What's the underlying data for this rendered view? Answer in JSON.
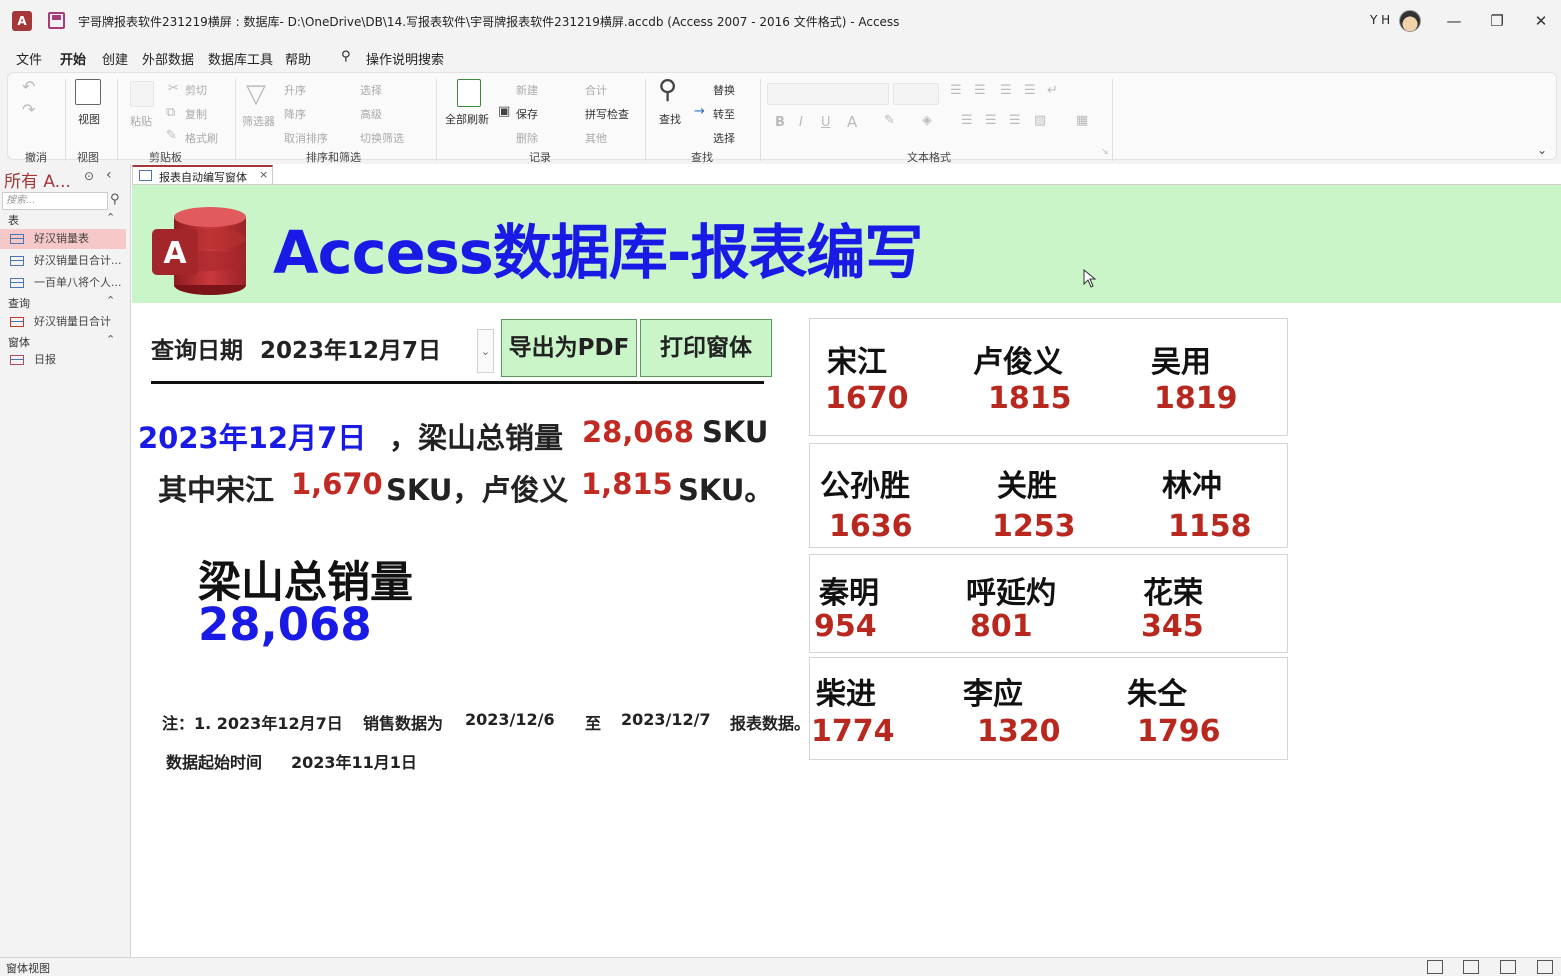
{
  "window": {
    "title": "宇哥牌报表软件231219横屏 : 数据库- D:\\OneDrive\\DB\\14.写报表软件\\宇哥牌报表软件231219横屏.accdb (Access 2007 - 2016 文件格式)  -  Access",
    "user": "Y H",
    "app_icon_letter": "A",
    "minimize": "—",
    "restore": "❐",
    "close": "✕"
  },
  "menu": {
    "items": [
      "文件",
      "开始",
      "创建",
      "外部数据",
      "数据库工具",
      "帮助"
    ],
    "active": "开始",
    "search": "操作说明搜索"
  },
  "ribbon": {
    "undo_group": "撤消",
    "view_group": "视图",
    "view_label": "视图",
    "clipboard_group": "剪贴板",
    "paste": "粘贴",
    "cut": "剪切",
    "copy": "复制",
    "format_painter": "格式刷",
    "sort_filter_group": "排序和筛选",
    "filter": "筛选器",
    "ascending": "升序",
    "descending": "降序",
    "remove_sort": "取消排序",
    "selection": "选择",
    "advanced": "高级",
    "toggle_filter": "切换筛选",
    "records_group": "记录",
    "refresh_all": "全部刷新",
    "new": "新建",
    "save": "保存",
    "delete": "删除",
    "totals": "合计",
    "spelling": "拼写检查",
    "more": "其他",
    "find_group": "查找",
    "find": "查找",
    "replace": "替换",
    "goto": "转至",
    "select": "选择",
    "text_format_group": "文本格式",
    "bold": "B",
    "italic": "I",
    "underline": "U"
  },
  "nav": {
    "title": "所有 A...",
    "search_placeholder": "搜索...",
    "sections": [
      {
        "label": "表",
        "items": [
          "好汉销量表",
          "好汉销量日合计...",
          "一百单八将个人..."
        ]
      },
      {
        "label": "查询",
        "items": [
          "好汉销量日合计"
        ]
      },
      {
        "label": "窗体",
        "items": [
          "日报"
        ]
      }
    ],
    "selected": "好汉销量表"
  },
  "doc_tab": {
    "label": "报表自动编写窗体",
    "close": "×"
  },
  "form": {
    "banner_title": "Access数据库-报表编写",
    "logo_letter": "A",
    "date_caption": "查询日期",
    "date_value": "2023年12月7日",
    "export_pdf": "导出为PDF",
    "print_form": "打印窗体",
    "summary": {
      "line1_date": "2023年12月7日",
      "line1_text": "，梁山总销量",
      "line1_total": "28,068",
      "line1_unit": "SKU",
      "line2_prefix": "其中宋江",
      "line2_v1": "1,670",
      "line2_mid": "SKU，卢俊义",
      "line2_v2": "1,815",
      "line2_suffix": "SKU。"
    },
    "total_caption": "梁山总销量",
    "total_value": "28,068",
    "note": {
      "prefix": "注：1. 2023年12月7日",
      "mid": "销售数据为",
      "from": "2023/12/6",
      "to_word": "至",
      "to": "2023/12/7",
      "suffix": "报表数据。",
      "start_label": "数据起始时间",
      "start_value": "2023年11月1日"
    },
    "heroes": [
      [
        {
          "name": "宋江",
          "value": "1670"
        },
        {
          "name": "卢俊义",
          "value": "1815"
        },
        {
          "name": "吴用",
          "value": "1819"
        }
      ],
      [
        {
          "name": "公孙胜",
          "value": "1636"
        },
        {
          "name": "关胜",
          "value": "1253"
        },
        {
          "name": "林冲",
          "value": "1158"
        }
      ],
      [
        {
          "name": "秦明",
          "value": "954"
        },
        {
          "name": "呼延灼",
          "value": "801"
        },
        {
          "name": "花荣",
          "value": "345"
        }
      ],
      [
        {
          "name": "柴进",
          "value": "1774"
        },
        {
          "name": "李应",
          "value": "1320"
        },
        {
          "name": "朱仝",
          "value": "1796"
        }
      ]
    ]
  },
  "status": {
    "text": "窗体视图"
  },
  "colors": {
    "banner_bg": "#c9f5c9",
    "title_blue": "#1a1ae6",
    "value_red": "#c02a22",
    "access_red": "#a4373a"
  }
}
